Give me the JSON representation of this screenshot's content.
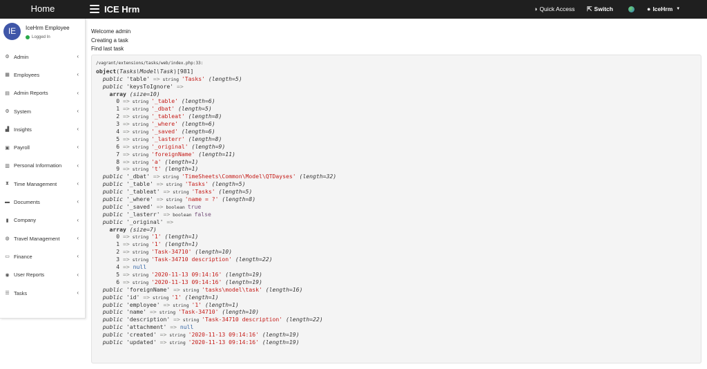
{
  "topbar": {
    "brand": "Home",
    "app_title": "ICE Hrm",
    "quick_access": "Quick Access",
    "switch": "Switch",
    "user": "IceHrm"
  },
  "user_panel": {
    "avatar_initials": "IE",
    "name": "IceHrm Employee",
    "status": "Logged In"
  },
  "sidebar": {
    "items": [
      {
        "label": "Admin",
        "icon": "cubes-icon",
        "glyph": "⚙"
      },
      {
        "label": "Employees",
        "icon": "grid-icon",
        "glyph": "▦"
      },
      {
        "label": "Admin Reports",
        "icon": "file-icon",
        "glyph": "▤"
      },
      {
        "label": "System",
        "icon": "cogs-icon",
        "glyph": "⚙"
      },
      {
        "label": "Insights",
        "icon": "chart-icon",
        "glyph": "▟"
      },
      {
        "label": "Payroll",
        "icon": "calculator-icon",
        "glyph": "▣"
      },
      {
        "label": "Personal Information",
        "icon": "id-card-icon",
        "glyph": "▥"
      },
      {
        "label": "Time Management",
        "icon": "hourglass-icon",
        "glyph": "⧗"
      },
      {
        "label": "Documents",
        "icon": "folder-icon",
        "glyph": "▬"
      },
      {
        "label": "Company",
        "icon": "building-icon",
        "glyph": "▮"
      },
      {
        "label": "Travel Management",
        "icon": "globe-icon",
        "glyph": "◍"
      },
      {
        "label": "Finance",
        "icon": "money-icon",
        "glyph": "▭"
      },
      {
        "label": "User Reports",
        "icon": "user-report-icon",
        "glyph": "◉"
      },
      {
        "label": "Tasks",
        "icon": "list-icon",
        "glyph": "☰"
      }
    ]
  },
  "messages": [
    "Welcome admin",
    "Creating a task",
    "Find last task"
  ],
  "dump": {
    "location": "/vagrant/extensions/tasks/web/index.php:33:",
    "lines": [
      [
        [
          "b",
          "object"
        ],
        [
          "",
          "("
        ],
        [
          "kw",
          "Tasks\\Model\\Task"
        ],
        [
          "",
          ")[981]"
        ]
      ],
      [
        [
          "",
          "  "
        ],
        [
          "kw",
          "public"
        ],
        [
          "",
          " 'table' "
        ],
        [
          "arr",
          "=>"
        ],
        [
          "typ",
          " string "
        ],
        [
          "str",
          "'Tasks'"
        ],
        [
          "len",
          " (length=5)"
        ]
      ],
      [
        [
          "",
          "  "
        ],
        [
          "kw",
          "public"
        ],
        [
          "",
          " 'keysToIgnore' "
        ],
        [
          "arr",
          "=>"
        ]
      ],
      [
        [
          "",
          "    "
        ],
        [
          "b",
          "array"
        ],
        [
          "len",
          " (size=10)"
        ]
      ],
      [
        [
          "",
          "      0 "
        ],
        [
          "arr",
          "=>"
        ],
        [
          "typ",
          " string "
        ],
        [
          "str",
          "'_table'"
        ],
        [
          "len",
          " (length=6)"
        ]
      ],
      [
        [
          "",
          "      1 "
        ],
        [
          "arr",
          "=>"
        ],
        [
          "typ",
          " string "
        ],
        [
          "str",
          "'_dbat'"
        ],
        [
          "len",
          " (length=5)"
        ]
      ],
      [
        [
          "",
          "      2 "
        ],
        [
          "arr",
          "=>"
        ],
        [
          "typ",
          " string "
        ],
        [
          "str",
          "'_tableat'"
        ],
        [
          "len",
          " (length=8)"
        ]
      ],
      [
        [
          "",
          "      3 "
        ],
        [
          "arr",
          "=>"
        ],
        [
          "typ",
          " string "
        ],
        [
          "str",
          "'_where'"
        ],
        [
          "len",
          " (length=6)"
        ]
      ],
      [
        [
          "",
          "      4 "
        ],
        [
          "arr",
          "=>"
        ],
        [
          "typ",
          " string "
        ],
        [
          "str",
          "'_saved'"
        ],
        [
          "len",
          " (length=6)"
        ]
      ],
      [
        [
          "",
          "      5 "
        ],
        [
          "arr",
          "=>"
        ],
        [
          "typ",
          " string "
        ],
        [
          "str",
          "'_lasterr'"
        ],
        [
          "len",
          " (length=8)"
        ]
      ],
      [
        [
          "",
          "      6 "
        ],
        [
          "arr",
          "=>"
        ],
        [
          "typ",
          " string "
        ],
        [
          "str",
          "'_original'"
        ],
        [
          "len",
          " (length=9)"
        ]
      ],
      [
        [
          "",
          "      7 "
        ],
        [
          "arr",
          "=>"
        ],
        [
          "typ",
          " string "
        ],
        [
          "str",
          "'foreignName'"
        ],
        [
          "len",
          " (length=11)"
        ]
      ],
      [
        [
          "",
          "      8 "
        ],
        [
          "arr",
          "=>"
        ],
        [
          "typ",
          " string "
        ],
        [
          "str",
          "'a'"
        ],
        [
          "len",
          " (length=1)"
        ]
      ],
      [
        [
          "",
          "      9 "
        ],
        [
          "arr",
          "=>"
        ],
        [
          "typ",
          " string "
        ],
        [
          "str",
          "'t'"
        ],
        [
          "len",
          " (length=1)"
        ]
      ],
      [
        [
          "",
          "  "
        ],
        [
          "kw",
          "public"
        ],
        [
          "",
          " '_dbat' "
        ],
        [
          "arr",
          "=>"
        ],
        [
          "typ",
          " string "
        ],
        [
          "str",
          "'TimeSheets\\Common\\Model\\QTDayses'"
        ],
        [
          "len",
          " (length=32)"
        ]
      ],
      [
        [
          "",
          "  "
        ],
        [
          "kw",
          "public"
        ],
        [
          "",
          " '_table' "
        ],
        [
          "arr",
          "=>"
        ],
        [
          "typ",
          " string "
        ],
        [
          "str",
          "'Tasks'"
        ],
        [
          "len",
          " (length=5)"
        ]
      ],
      [
        [
          "",
          "  "
        ],
        [
          "kw",
          "public"
        ],
        [
          "",
          " '_tableat' "
        ],
        [
          "arr",
          "=>"
        ],
        [
          "typ",
          " string "
        ],
        [
          "str",
          "'Tasks'"
        ],
        [
          "len",
          " (length=5)"
        ]
      ],
      [
        [
          "",
          "  "
        ],
        [
          "kw",
          "public"
        ],
        [
          "",
          " '_where' "
        ],
        [
          "arr",
          "=>"
        ],
        [
          "typ",
          " string "
        ],
        [
          "str",
          "'name = ?'"
        ],
        [
          "len",
          " (length=8)"
        ]
      ],
      [
        [
          "",
          "  "
        ],
        [
          "kw",
          "public"
        ],
        [
          "",
          " '_saved' "
        ],
        [
          "arr",
          "=>"
        ],
        [
          "typ",
          " boolean "
        ],
        [
          "bool",
          "true"
        ]
      ],
      [
        [
          "",
          "  "
        ],
        [
          "kw",
          "public"
        ],
        [
          "",
          " '_lasterr' "
        ],
        [
          "arr",
          "=>"
        ],
        [
          "typ",
          " boolean "
        ],
        [
          "bool",
          "false"
        ]
      ],
      [
        [
          "",
          "  "
        ],
        [
          "kw",
          "public"
        ],
        [
          "",
          " '_original' "
        ],
        [
          "arr",
          "=>"
        ]
      ],
      [
        [
          "",
          "    "
        ],
        [
          "b",
          "array"
        ],
        [
          "len",
          " (size=7)"
        ]
      ],
      [
        [
          "",
          "      0 "
        ],
        [
          "arr",
          "=>"
        ],
        [
          "typ",
          " string "
        ],
        [
          "str",
          "'1'"
        ],
        [
          "len",
          " (length=1)"
        ]
      ],
      [
        [
          "",
          "      1 "
        ],
        [
          "arr",
          "=>"
        ],
        [
          "typ",
          " string "
        ],
        [
          "str",
          "'1'"
        ],
        [
          "len",
          " (length=1)"
        ]
      ],
      [
        [
          "",
          "      2 "
        ],
        [
          "arr",
          "=>"
        ],
        [
          "typ",
          " string "
        ],
        [
          "str",
          "'Task-34710'"
        ],
        [
          "len",
          " (length=10)"
        ]
      ],
      [
        [
          "",
          "      3 "
        ],
        [
          "arr",
          "=>"
        ],
        [
          "typ",
          " string "
        ],
        [
          "str",
          "'Task-34710 description'"
        ],
        [
          "len",
          " (length=22)"
        ]
      ],
      [
        [
          "",
          "      4 "
        ],
        [
          "arr",
          "=>"
        ],
        [
          "nul",
          " null"
        ]
      ],
      [
        [
          "",
          "      5 "
        ],
        [
          "arr",
          "=>"
        ],
        [
          "typ",
          " string "
        ],
        [
          "str",
          "'2020-11-13 09:14:16'"
        ],
        [
          "len",
          " (length=19)"
        ]
      ],
      [
        [
          "",
          "      6 "
        ],
        [
          "arr",
          "=>"
        ],
        [
          "typ",
          " string "
        ],
        [
          "str",
          "'2020-11-13 09:14:16'"
        ],
        [
          "len",
          " (length=19)"
        ]
      ],
      [
        [
          "",
          "  "
        ],
        [
          "kw",
          "public"
        ],
        [
          "",
          " 'foreignName' "
        ],
        [
          "arr",
          "=>"
        ],
        [
          "typ",
          " string "
        ],
        [
          "str",
          "'tasks\\model\\task'"
        ],
        [
          "len",
          " (length=16)"
        ]
      ],
      [
        [
          "",
          "  "
        ],
        [
          "kw",
          "public"
        ],
        [
          "",
          " 'id' "
        ],
        [
          "arr",
          "=>"
        ],
        [
          "typ",
          " string "
        ],
        [
          "str",
          "'1'"
        ],
        [
          "len",
          " (length=1)"
        ]
      ],
      [
        [
          "",
          "  "
        ],
        [
          "kw",
          "public"
        ],
        [
          "",
          " 'employee' "
        ],
        [
          "arr",
          "=>"
        ],
        [
          "typ",
          " string "
        ],
        [
          "str",
          "'1'"
        ],
        [
          "len",
          " (length=1)"
        ]
      ],
      [
        [
          "",
          "  "
        ],
        [
          "kw",
          "public"
        ],
        [
          "",
          " 'name' "
        ],
        [
          "arr",
          "=>"
        ],
        [
          "typ",
          " string "
        ],
        [
          "str",
          "'Task-34710'"
        ],
        [
          "len",
          " (length=10)"
        ]
      ],
      [
        [
          "",
          "  "
        ],
        [
          "kw",
          "public"
        ],
        [
          "",
          " 'description' "
        ],
        [
          "arr",
          "=>"
        ],
        [
          "typ",
          " string "
        ],
        [
          "str",
          "'Task-34710 description'"
        ],
        [
          "len",
          " (length=22)"
        ]
      ],
      [
        [
          "",
          "  "
        ],
        [
          "kw",
          "public"
        ],
        [
          "",
          " 'attachment' "
        ],
        [
          "arr",
          "=>"
        ],
        [
          "nul",
          " null"
        ]
      ],
      [
        [
          "",
          "  "
        ],
        [
          "kw",
          "public"
        ],
        [
          "",
          " 'created' "
        ],
        [
          "arr",
          "=>"
        ],
        [
          "typ",
          " string "
        ],
        [
          "str",
          "'2020-11-13 09:14:16'"
        ],
        [
          "len",
          " (length=19)"
        ]
      ],
      [
        [
          "",
          "  "
        ],
        [
          "kw",
          "public"
        ],
        [
          "",
          " 'updated' "
        ],
        [
          "arr",
          "=>"
        ],
        [
          "typ",
          " string "
        ],
        [
          "str",
          "'2020-11-13 09:14:16'"
        ],
        [
          "len",
          " (length=19)"
        ]
      ]
    ]
  }
}
